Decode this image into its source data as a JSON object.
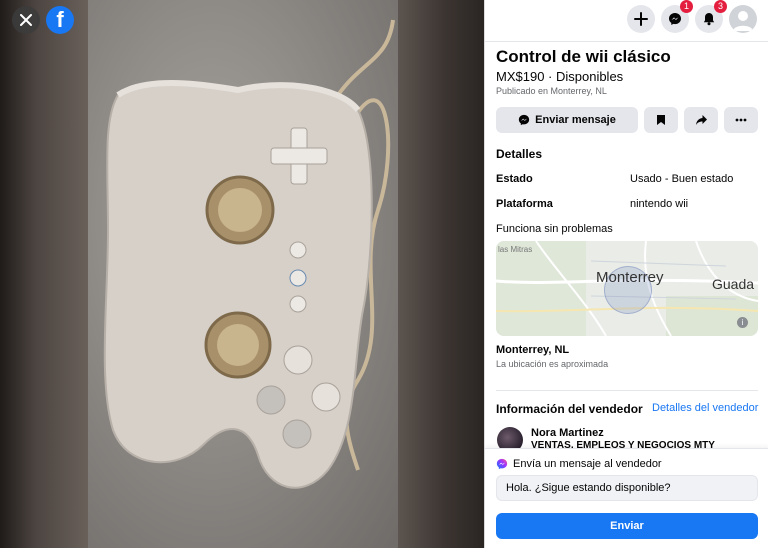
{
  "viewer": {
    "close_icon": "close-icon",
    "logo_icon": "facebook-logo",
    "logo_letter": "f"
  },
  "topbar": {
    "create_icon": "plus-icon",
    "messenger_icon": "messenger-icon",
    "messenger_badge": "1",
    "notifications_icon": "bell-icon",
    "notifications_badge": "3",
    "profile_icon": "avatar"
  },
  "listing": {
    "title": "Control de wii clásico",
    "price": "MX$190 · Disponibles",
    "published": "Publicado en Monterrey, NL"
  },
  "actions": {
    "message_label": "Enviar mensaje",
    "save_icon": "bookmark-icon",
    "share_icon": "share-icon",
    "more_icon": "more-icon"
  },
  "details": {
    "heading": "Detalles",
    "rows": [
      {
        "label": "Estado",
        "value": "Usado - Buen estado"
      },
      {
        "label": "Plataforma",
        "value": "nintendo wii"
      }
    ],
    "description": "Funciona sin problemas"
  },
  "map": {
    "city_label": "Monterrey",
    "neighbor_label": "Guada",
    "district_label": "las Mitras"
  },
  "location": {
    "name": "Monterrey, NL",
    "note": "La ubicación es aproximada"
  },
  "seller": {
    "heading": "Información del vendedor",
    "details_link": "Detalles del vendedor",
    "name": "Nora Martinez",
    "group": "VENTAS, EMPLEOS Y NEGOCIOS MTY"
  },
  "compose": {
    "label": "Envía un mensaje al vendedor",
    "message": "Hola. ¿Sigue estando disponible?",
    "send_label": "Enviar"
  },
  "colors": {
    "accent": "#1877f2",
    "badge": "#e41e3f",
    "button_gray": "#e4e6eb"
  }
}
